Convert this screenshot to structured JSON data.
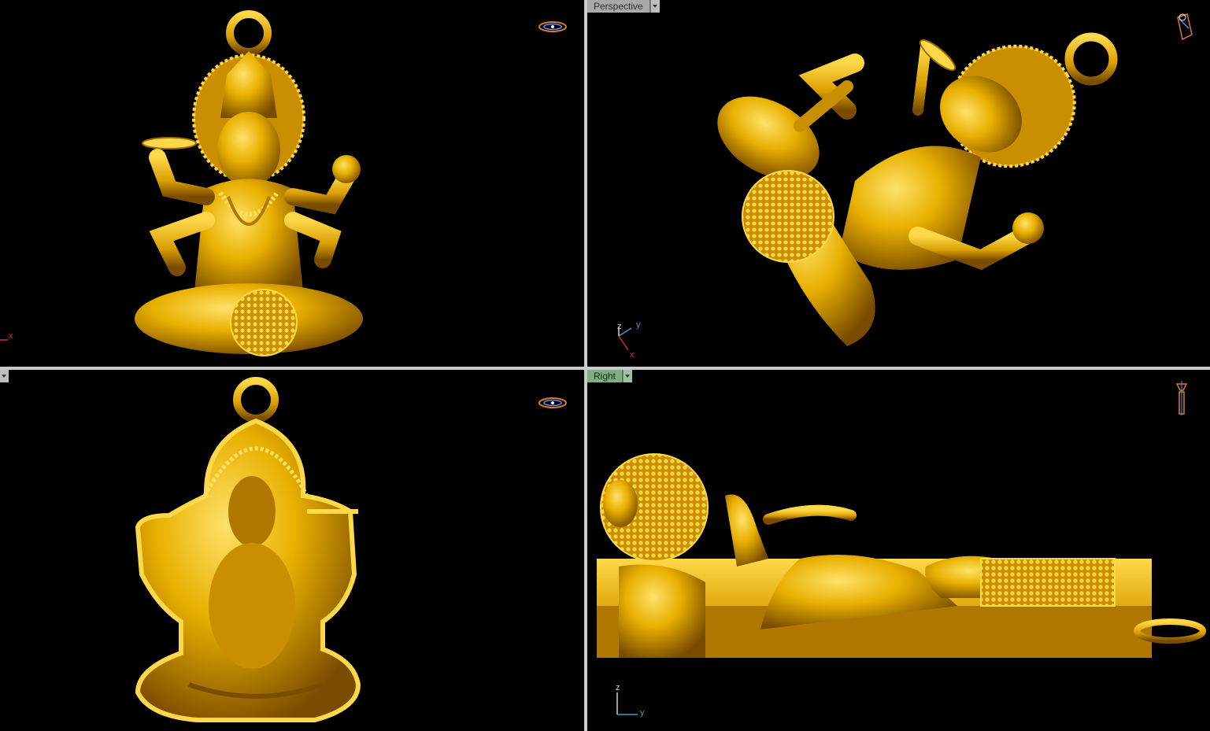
{
  "viewports": {
    "top_left": {
      "axis": {
        "x": "x"
      }
    },
    "top_right": {
      "label": "Perspective",
      "axis": {
        "x": "x",
        "y": "y",
        "z": "z"
      }
    },
    "bottom_left": {
      "label": ""
    },
    "bottom_right": {
      "label": "Right",
      "axis": {
        "y": "y",
        "z": "z"
      }
    }
  },
  "colors": {
    "background": "#000000",
    "model_gold": "#e8b000",
    "model_highlight": "#ffd84a",
    "model_shadow": "#8a5a00",
    "divider": "#c9c9c9",
    "active_tab": "#7fae83",
    "axis_x": "#d03030",
    "axis_y": "#3aa0c8",
    "axis_z": "#cfcfcf"
  },
  "icons": [
    "view-cube-icon",
    "perspective-camera-icon",
    "right-view-camera-icon"
  ]
}
